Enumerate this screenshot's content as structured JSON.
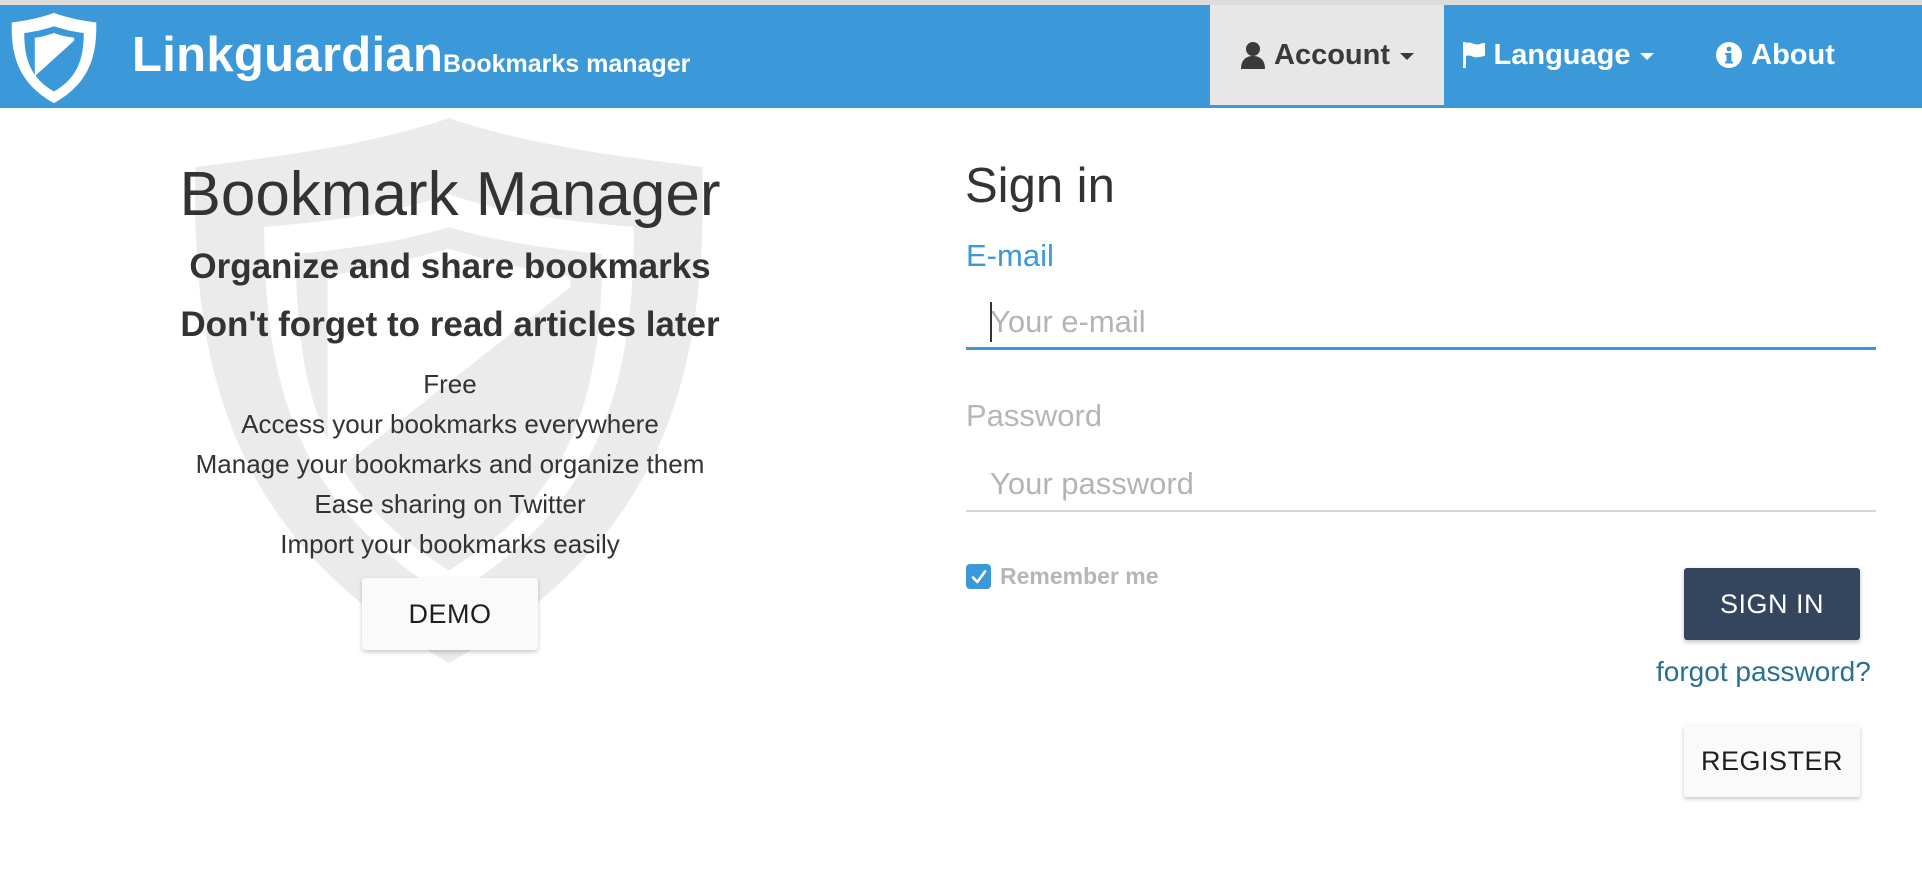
{
  "brand": {
    "name": "Linkguardian",
    "tagline": "Bookmarks manager",
    "logo_icon": "shield-icon"
  },
  "nav": {
    "account": {
      "label": "Account",
      "icon": "user-icon",
      "active": true
    },
    "language": {
      "label": "Language",
      "icon": "flag-icon"
    },
    "about": {
      "label": "About",
      "icon": "info-icon"
    }
  },
  "hero": {
    "title": "Bookmark Manager",
    "subtitle1": "Organize and share bookmarks",
    "subtitle2": "Don't forget to read articles later",
    "features": [
      "Free",
      "Access your bookmarks everywhere",
      "Manage your bookmarks and organize them",
      "Ease sharing on Twitter",
      "Import your bookmarks easily"
    ],
    "demo_label": "DEMO"
  },
  "signin": {
    "title": "Sign in",
    "email_label": "E-mail",
    "email_placeholder": "Your e-mail",
    "email_value": "",
    "password_label": "Password",
    "password_placeholder": "Your password",
    "password_value": "",
    "remember_label": "Remember me",
    "remember_checked": true,
    "signin_label": "SIGN IN",
    "forgot_label": "forgot password?",
    "register_label": "REGISTER"
  },
  "colors": {
    "primary": "#3b99d9",
    "signin_button": "#34465e",
    "link": "#296e95",
    "muted": "#b6b6b6"
  }
}
